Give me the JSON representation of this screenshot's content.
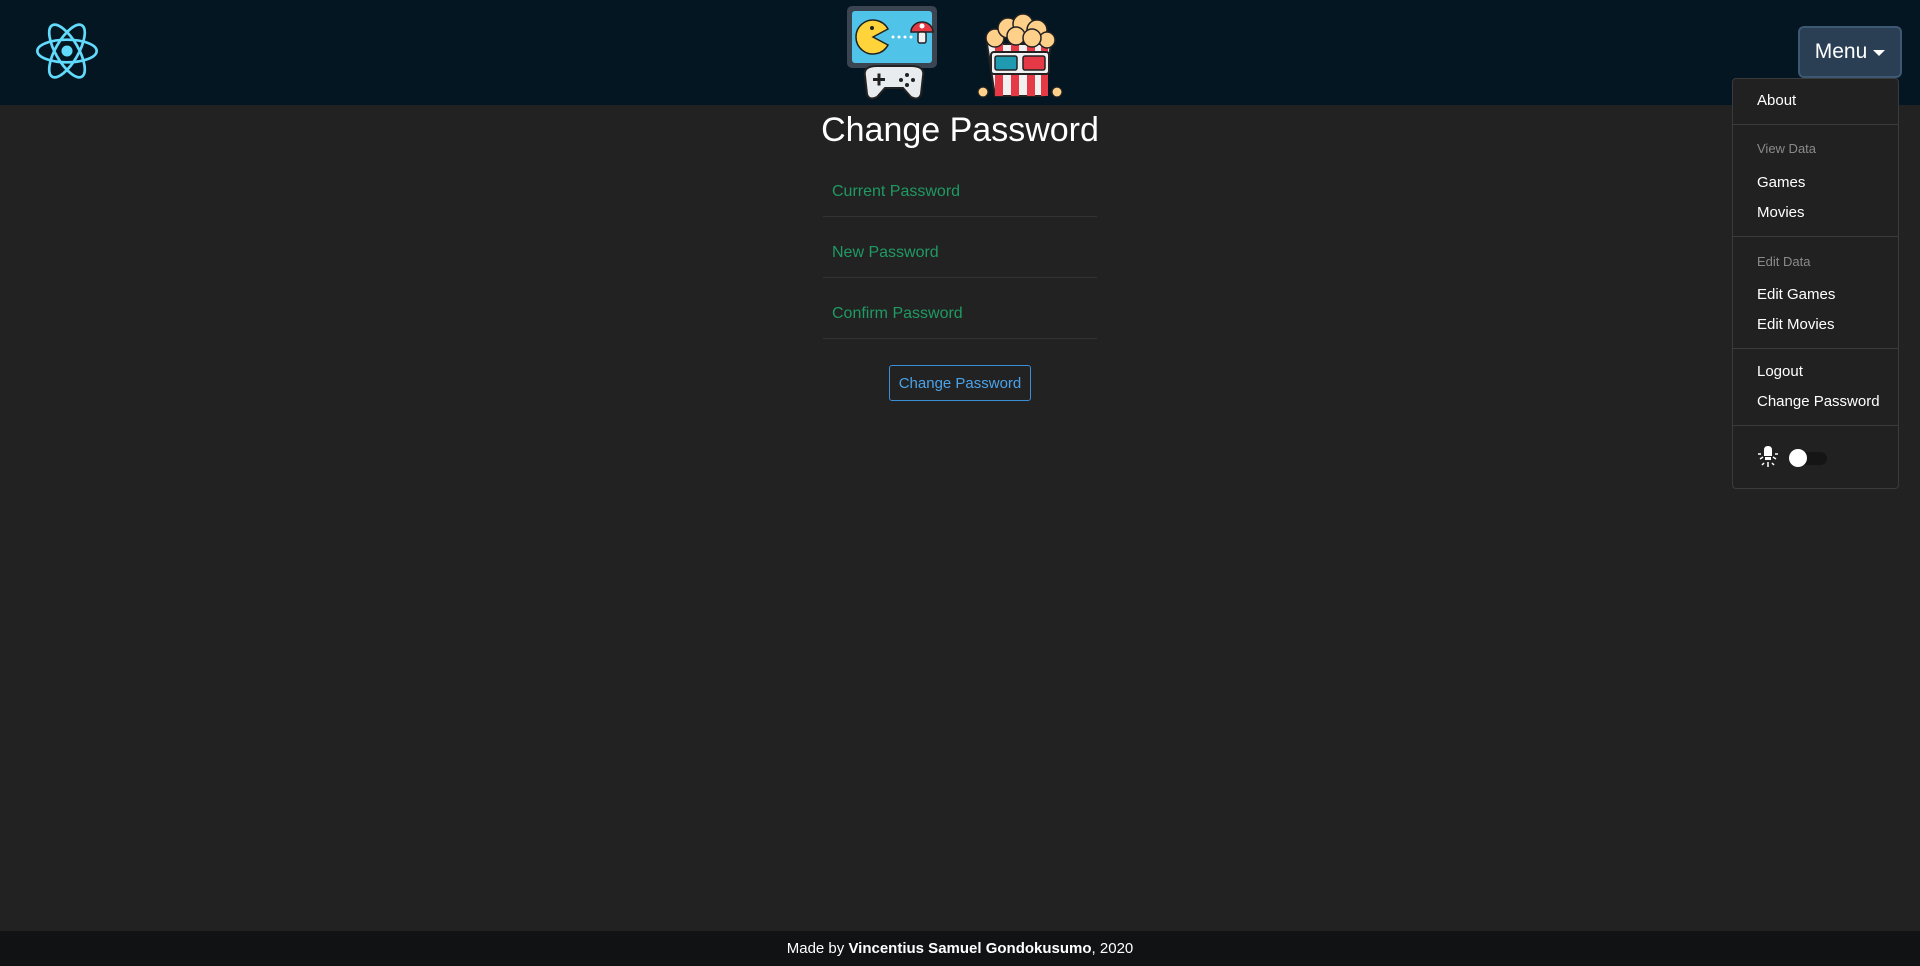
{
  "header": {
    "menu_label": "Menu"
  },
  "dropdown": {
    "about": "About",
    "view_header": "View Data",
    "games": "Games",
    "movies": "Movies",
    "edit_header": "Edit Data",
    "edit_games": "Edit Games",
    "edit_movies": "Edit Movies",
    "logout": "Logout",
    "change_password": "Change Password",
    "theme_toggle_on": false
  },
  "main": {
    "title": "Change Password",
    "current_password_placeholder": "Current Password",
    "new_password_placeholder": "New Password",
    "confirm_password_placeholder": "Confirm Password",
    "submit_label": "Change Password"
  },
  "footer": {
    "prefix": "Made by ",
    "author": "Vincentius Samuel Gondokusumo",
    "suffix": ", 2020"
  },
  "colors": {
    "header_bg": "#041622",
    "page_bg": "#222222",
    "field_text": "#1f9a63",
    "button_accent": "#3a8fd6",
    "react_blue": "#61dafb"
  }
}
